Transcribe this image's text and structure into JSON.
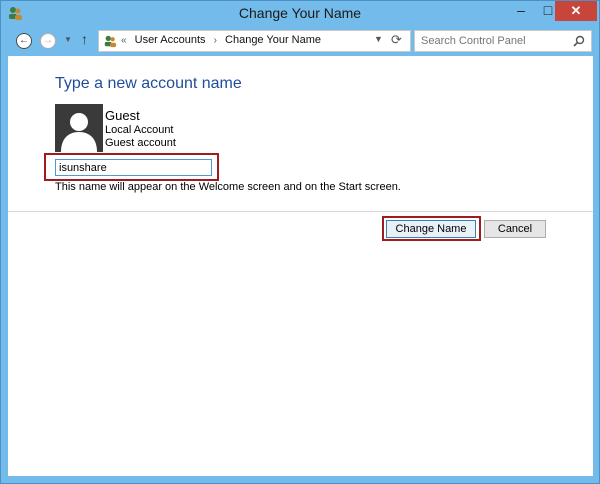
{
  "window": {
    "title": "Change Your Name",
    "controls": {
      "minimize": "–",
      "maximize": "□",
      "close": "✕"
    }
  },
  "nav": {
    "back_icon": "back-arrow-icon",
    "forward_icon": "forward-arrow-icon",
    "up_icon": "up-arrow-icon",
    "breadcrumb_prefix": "«",
    "breadcrumb": [
      "User Accounts",
      "Change Your Name"
    ],
    "breadcrumb_separator": "›",
    "search_placeholder": "Search Control Panel"
  },
  "content": {
    "heading": "Type a new account name",
    "account": {
      "name": "Guest",
      "type": "Local Account",
      "subtype": "Guest account"
    },
    "name_input_value": "isunshare",
    "hint": "This name will appear on the Welcome screen and on the Start screen.",
    "buttons": {
      "change": "Change Name",
      "cancel": "Cancel"
    }
  },
  "colors": {
    "frame": "#73bbea",
    "close_button": "#c7453b",
    "heading": "#1e4e9a",
    "highlight": "#9e1b20"
  }
}
